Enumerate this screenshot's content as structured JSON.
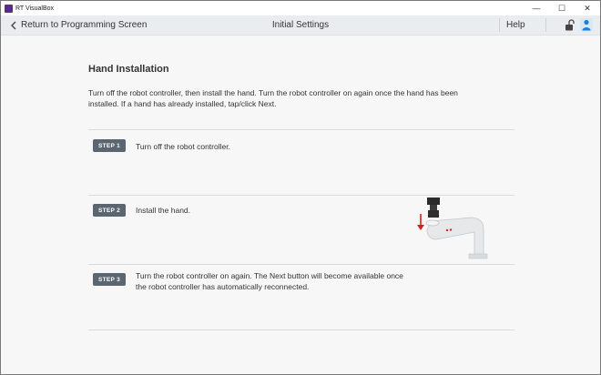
{
  "window": {
    "app_title": "RT VisualBox",
    "minimize": "—",
    "maximize": "☐",
    "close": "✕"
  },
  "header": {
    "back_label": "Return to Programming Screen",
    "title": "Initial Settings",
    "help_label": "Help"
  },
  "page": {
    "title": "Hand Installation",
    "intro": "Turn off the robot controller, then install the hand. Turn the robot controller on again once the hand has been installed. If a hand has already installed, tap/click Next."
  },
  "steps": [
    {
      "badge": "STEP 1",
      "text": "Turn off the robot controller."
    },
    {
      "badge": "STEP 2",
      "text": "Install the hand."
    },
    {
      "badge": "STEP 3",
      "text": "Turn the robot controller on again. The Next button will become available once the robot controller has automatically reconnected."
    }
  ],
  "icons": {
    "back": "chevron-left-icon",
    "lock": "unlock-icon",
    "user": "user-icon",
    "illustration": "robot-hand-illustration"
  },
  "colors": {
    "header_bg": "#eaedf0",
    "badge_bg": "#5c6670",
    "accent_blue": "#1f7fd6",
    "arrow_red": "#d42020"
  }
}
